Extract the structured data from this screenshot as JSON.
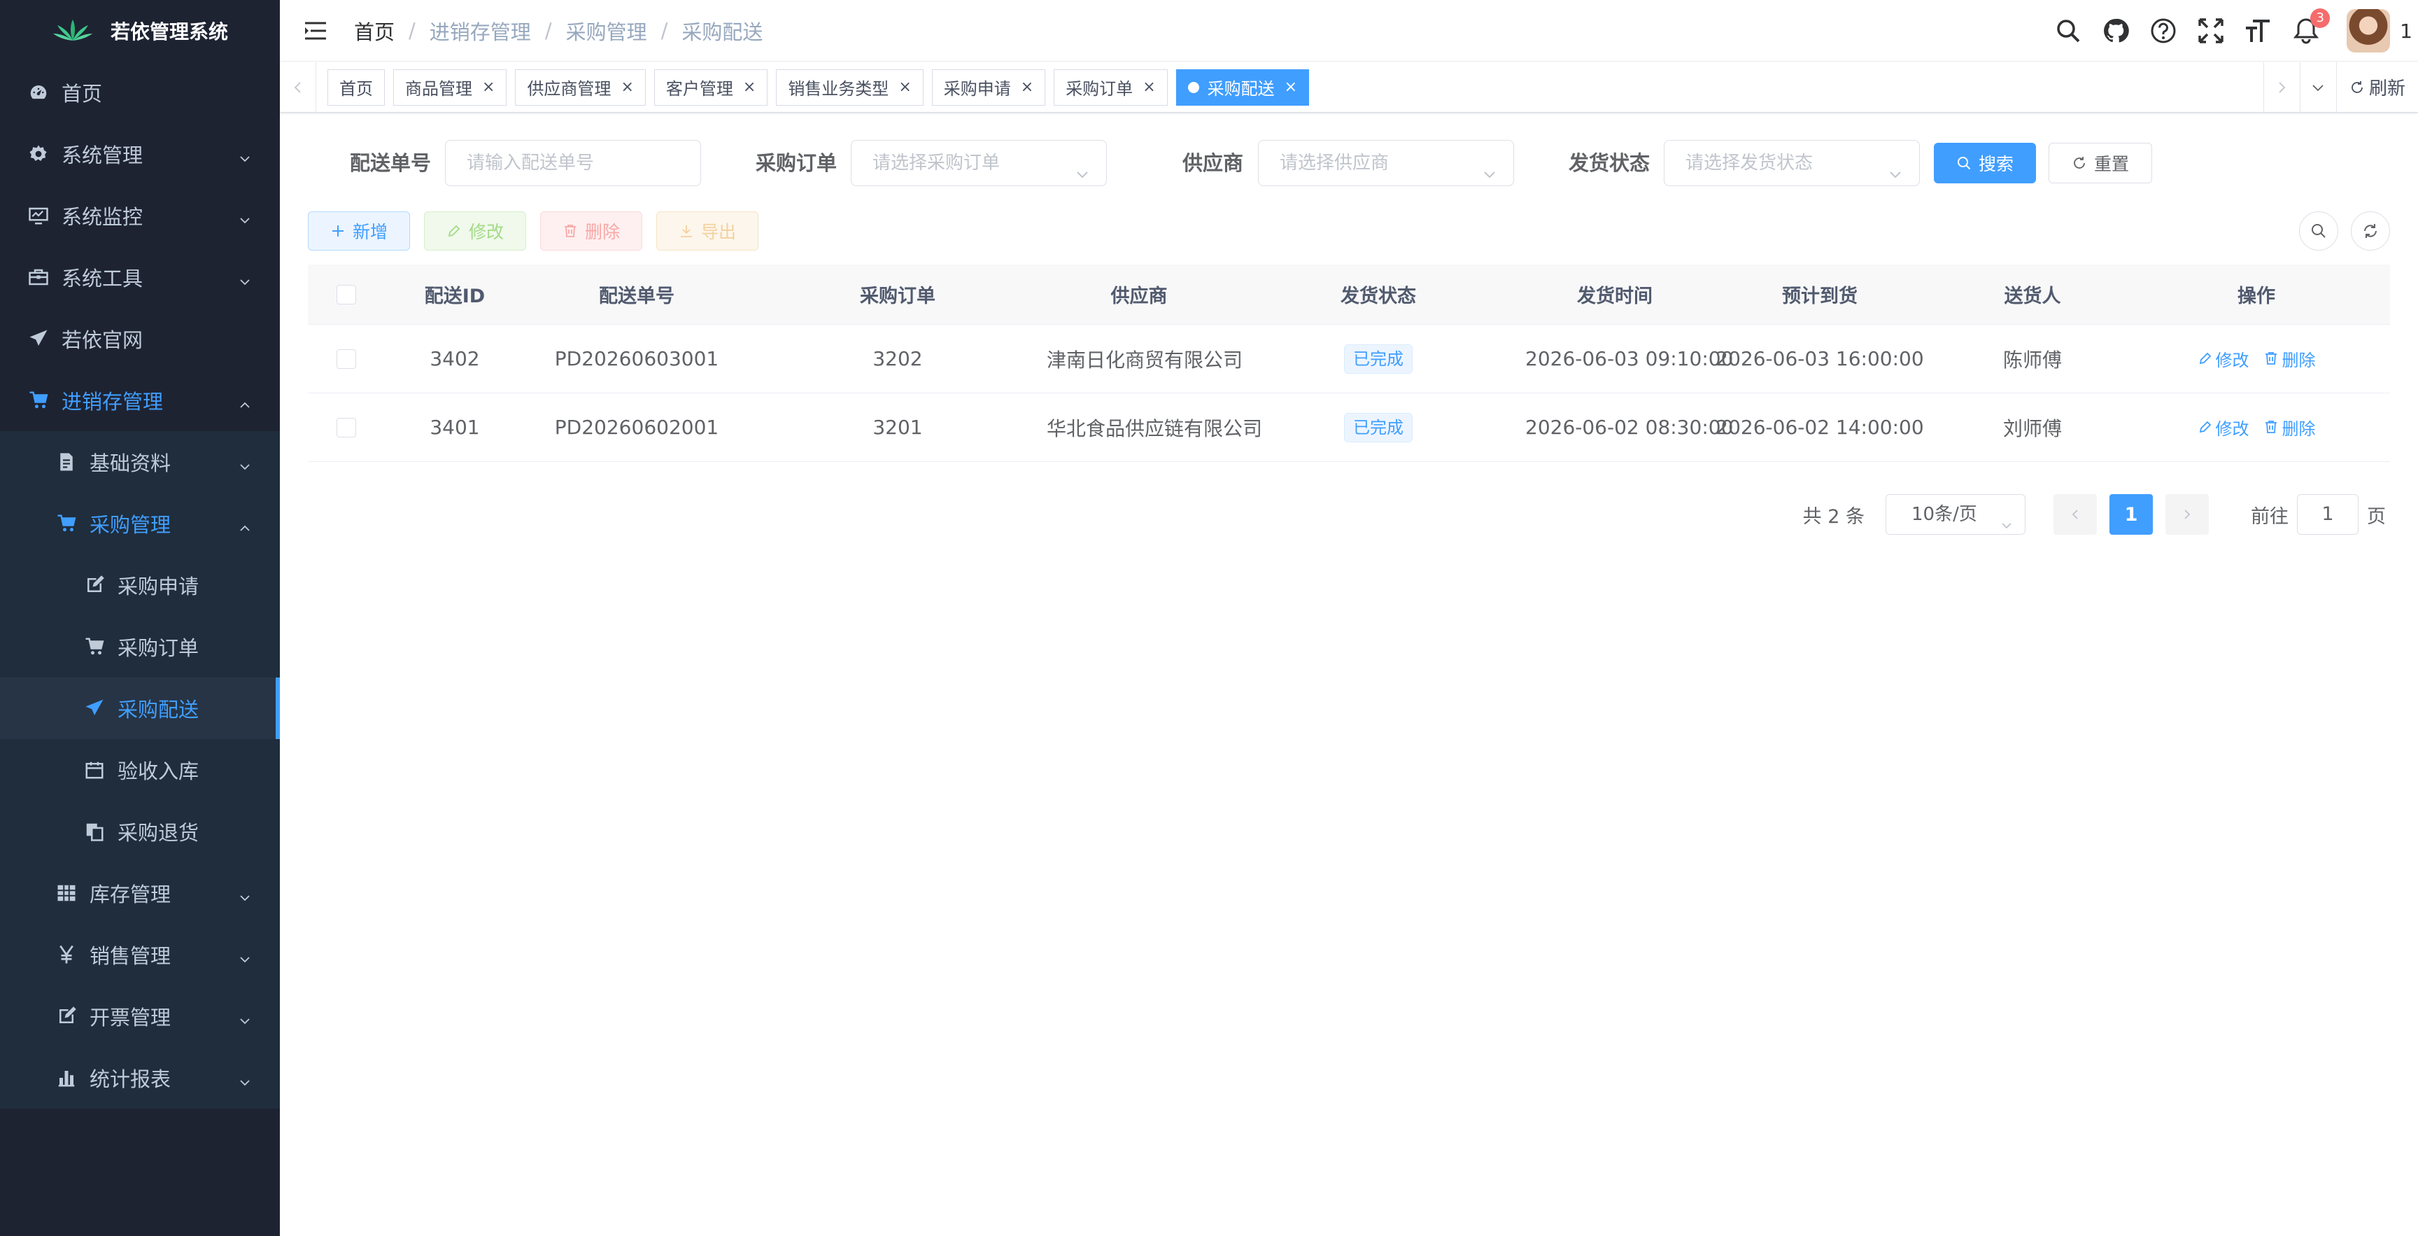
{
  "app": {
    "title": "若依管理系统",
    "user_suffix": "1",
    "notification_count": "3"
  },
  "sidebar": {
    "items": [
      {
        "label": "首页",
        "icon": "dashboard-icon"
      },
      {
        "label": "系统管理",
        "icon": "gear-icon"
      },
      {
        "label": "系统监控",
        "icon": "monitor-icon"
      },
      {
        "label": "系统工具",
        "icon": "toolbox-icon"
      },
      {
        "label": "若依官网",
        "icon": "paper-plane-icon"
      },
      {
        "label": "进销存管理",
        "icon": "cart-icon"
      },
      {
        "label": "基础资料",
        "icon": "document-icon"
      },
      {
        "label": "采购管理",
        "icon": "cart-icon"
      },
      {
        "label": "采购申请",
        "icon": "edit-icon"
      },
      {
        "label": "采购订单",
        "icon": "cart-icon"
      },
      {
        "label": "采购配送",
        "icon": "paper-plane-icon"
      },
      {
        "label": "验收入库",
        "icon": "calendar-icon"
      },
      {
        "label": "采购退货",
        "icon": "copy-icon"
      },
      {
        "label": "库存管理",
        "icon": "grid-icon"
      },
      {
        "label": "销售管理",
        "icon": "yen-icon"
      },
      {
        "label": "开票管理",
        "icon": "edit-icon"
      },
      {
        "label": "统计报表",
        "icon": "bar-chart-icon"
      }
    ]
  },
  "breadcrumb": [
    "首页",
    "进销存管理",
    "采购管理",
    "采购配送"
  ],
  "tags": [
    "首页",
    "商品管理",
    "供应商管理",
    "客户管理",
    "销售业务类型",
    "采购申请",
    "采购订单",
    "采购配送"
  ],
  "tags_refresh": "刷新",
  "search": {
    "delivery_no_label": "配送单号",
    "delivery_no_placeholder": "请输入配送单号",
    "po_label": "采购订单",
    "po_placeholder": "请选择采购订单",
    "supplier_label": "供应商",
    "supplier_placeholder": "请选择供应商",
    "status_label": "发货状态",
    "status_placeholder": "请选择发货状态",
    "search_btn": "搜索",
    "reset_btn": "重置"
  },
  "toolbar": {
    "add": "新增",
    "edit": "修改",
    "delete": "删除",
    "export": "导出"
  },
  "table": {
    "headers": [
      "配送ID",
      "配送单号",
      "采购订单",
      "供应商",
      "发货状态",
      "发货时间",
      "预计到货",
      "送货人",
      "操作"
    ],
    "rows": [
      {
        "id": "3402",
        "no": "PD20260603001",
        "po": "3202",
        "supplier": "津南日化商贸有限公司",
        "status": "已完成",
        "ship_time": "2026-06-03 09:10:00",
        "eta": "2026-06-03 16:00:00",
        "courier": "陈师傅"
      },
      {
        "id": "3401",
        "no": "PD20260602001",
        "po": "3201",
        "supplier": "华北食品供应链有限公司",
        "status": "已完成",
        "ship_time": "2026-06-02 08:30:00",
        "eta": "2026-06-02 14:00:00",
        "courier": "刘师傅"
      }
    ],
    "op_edit": "修改",
    "op_delete": "删除"
  },
  "pagination": {
    "total": "共 2 条",
    "page_size": "10条/页",
    "current": "1",
    "goto_prefix": "前往",
    "goto_value": "1",
    "goto_suffix": "页"
  },
  "colors": {
    "primary": "#409eff",
    "sidebar_bg": "#1e2332",
    "sidebar_text": "#bfcbd9"
  }
}
